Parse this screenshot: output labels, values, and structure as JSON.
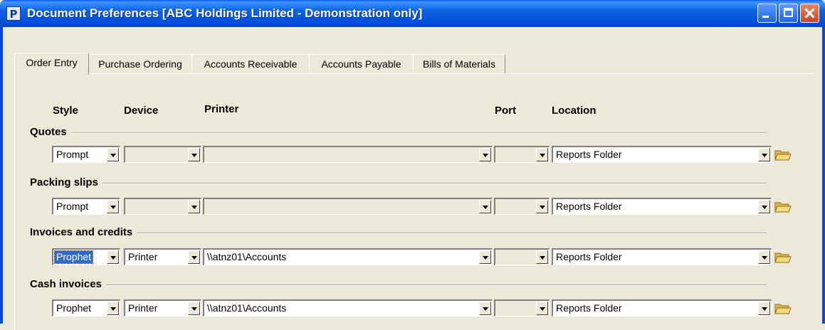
{
  "window": {
    "app_icon": "P",
    "title": "Document Preferences [ABC Holdings Limited - Demonstration only]"
  },
  "tabs": [
    {
      "label": "Order Entry",
      "active": true
    },
    {
      "label": "Purchase Ordering",
      "active": false
    },
    {
      "label": "Accounts Receivable",
      "active": false
    },
    {
      "label": "Accounts Payable",
      "active": false
    },
    {
      "label": "Bills of Materials",
      "active": false
    }
  ],
  "columns": {
    "style": "Style",
    "device": "Device",
    "printer": "Printer",
    "port": "Port",
    "location": "Location"
  },
  "sections": [
    {
      "label": "Quotes",
      "style": "Prompt",
      "device": "",
      "printer": "",
      "port": "",
      "location": "Reports Folder"
    },
    {
      "label": "Packing slips",
      "style": "Prompt",
      "device": "",
      "printer": "",
      "port": "",
      "location": "Reports Folder"
    },
    {
      "label": "Invoices and credits",
      "style": "Prophet",
      "device": "Printer",
      "printer": "\\\\atnz01\\Accounts",
      "port": "",
      "location": "Reports Folder"
    },
    {
      "label": "Cash invoices",
      "style": "Prophet",
      "device": "Printer",
      "printer": "\\\\atnz01\\Accounts",
      "port": "",
      "location": "Reports Folder"
    }
  ],
  "icons": {
    "browse": "folder-open-icon"
  },
  "colors": {
    "title_bar": "#0551D9",
    "selection": "#316AC5",
    "dialog_bg": "#ECE9D8"
  }
}
